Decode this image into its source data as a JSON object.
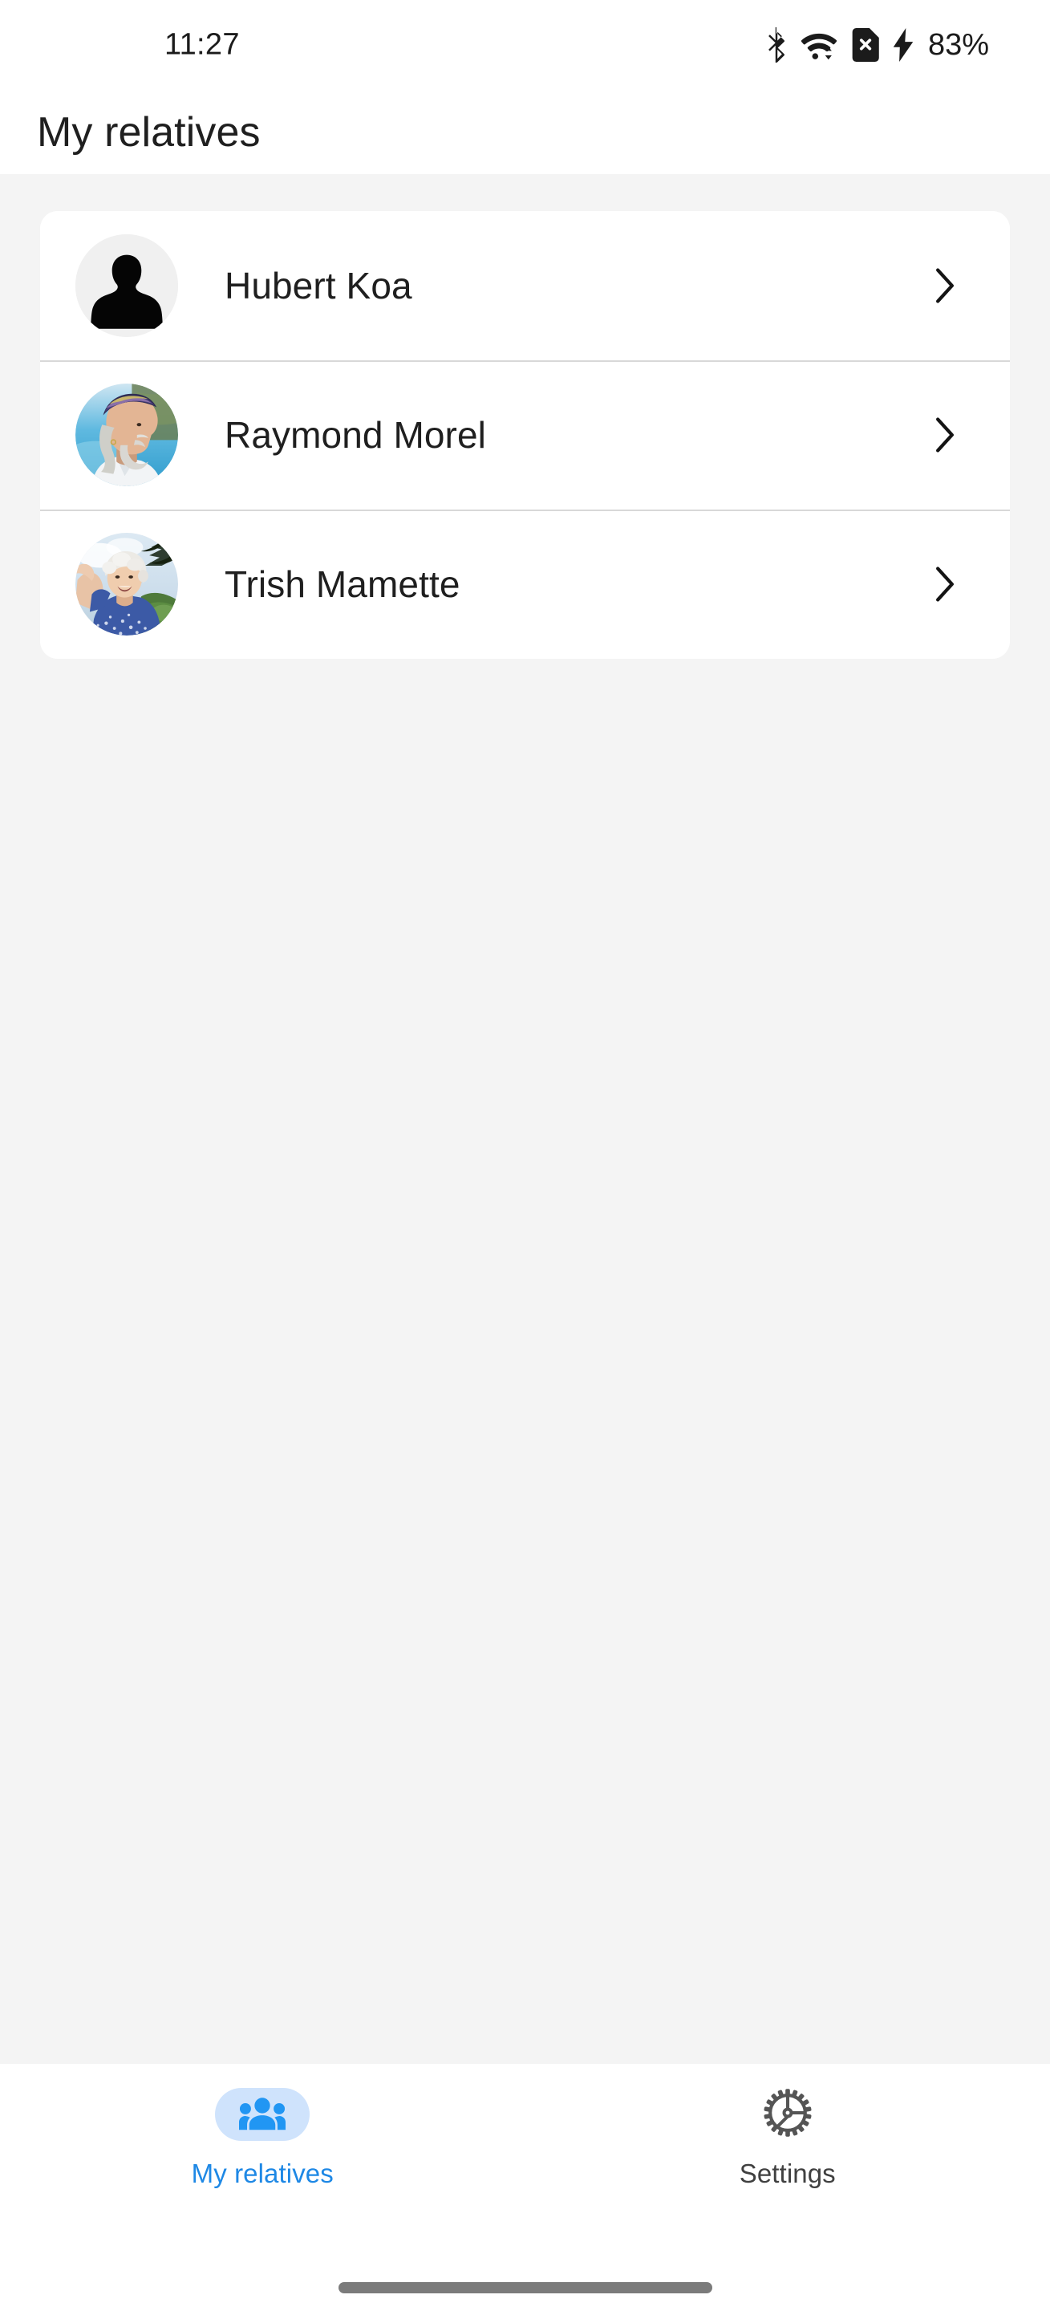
{
  "status_bar": {
    "time": "11:27",
    "battery_percent": "83%",
    "icons": [
      "bluetooth-icon",
      "wifi-icon",
      "sim-card-off-icon",
      "charging-bolt-icon"
    ]
  },
  "header": {
    "title": "My relatives"
  },
  "relatives": {
    "items": [
      {
        "name": "Hubert Koa",
        "avatar": "default-person-placeholder",
        "chevron": "chevron-right-icon"
      },
      {
        "name": "Raymond Morel",
        "avatar": "photo-elderly-man-bandana",
        "chevron": "chevron-right-icon"
      },
      {
        "name": "Trish Mamette",
        "avatar": "photo-elderly-woman-waving",
        "chevron": "chevron-right-icon"
      }
    ]
  },
  "bottom_nav": {
    "items": [
      {
        "label": "My relatives",
        "icon": "people-group-icon",
        "active": true
      },
      {
        "label": "Settings",
        "icon": "gear-icon",
        "active": false
      }
    ]
  },
  "colors": {
    "accent": "#1e88e5",
    "accent_pill": "#cfe3fc",
    "content_background": "#f4f4f4",
    "card_background": "#ffffff",
    "divider": "#d8d8d8",
    "text_primary": "#1f1f1f",
    "text_inactive": "#404040",
    "gesture_bar": "#7b7b7b"
  }
}
